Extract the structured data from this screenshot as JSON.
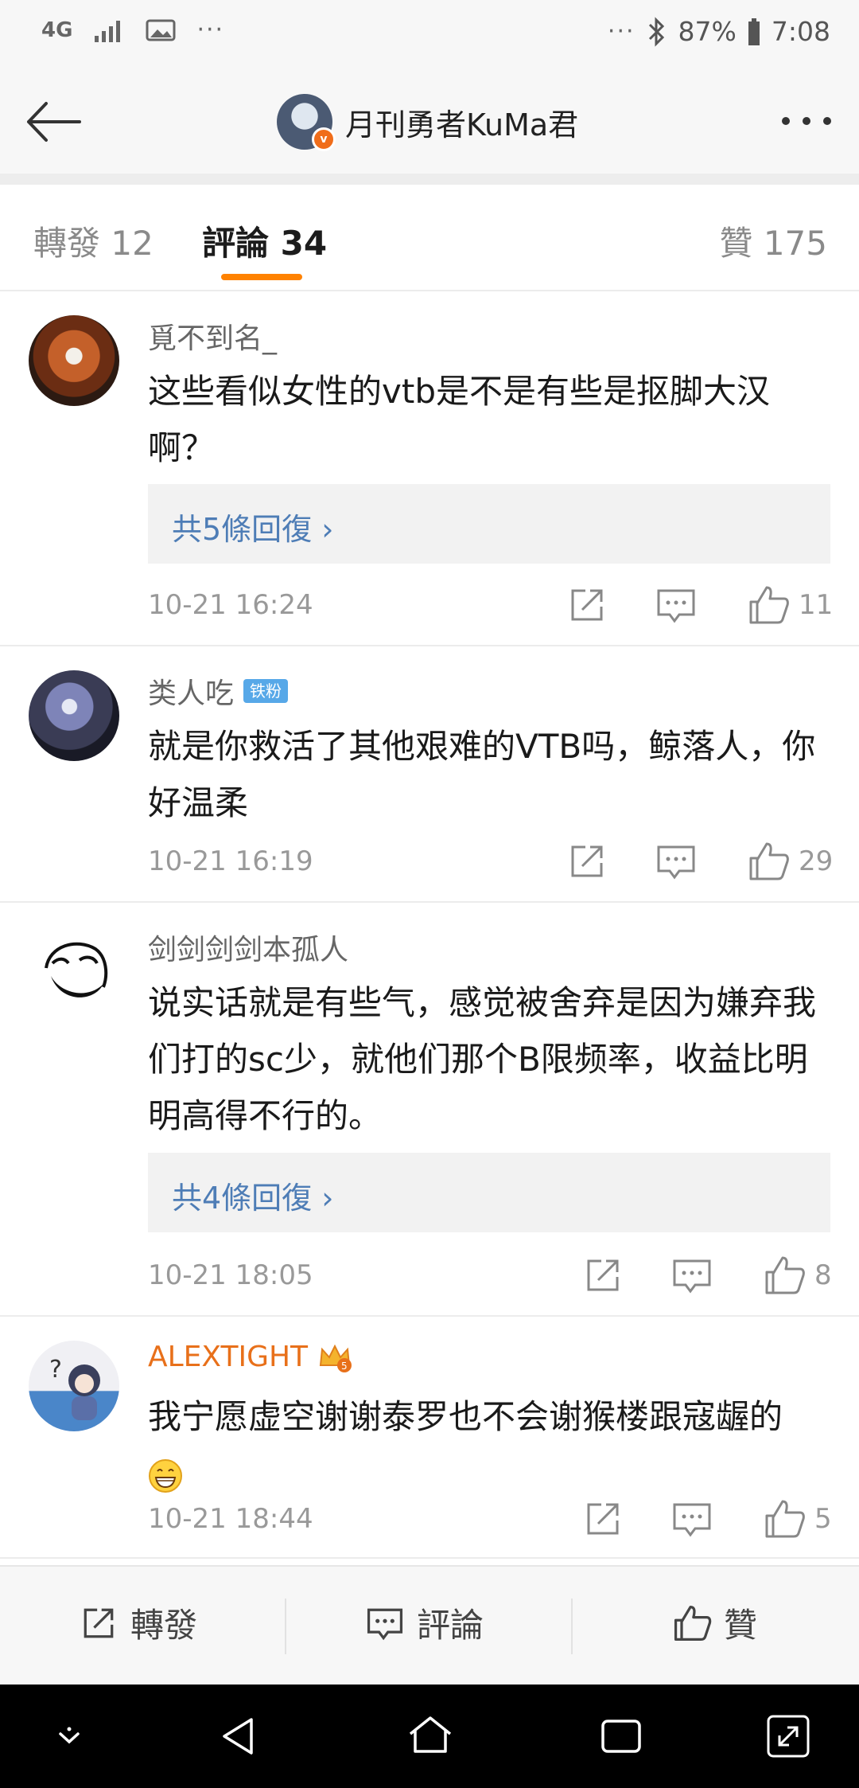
{
  "status_bar": {
    "network": "4G",
    "ellipsis_left": "···",
    "ellipsis_right": "···",
    "battery": "87%",
    "time": "7:08"
  },
  "header": {
    "author_name": "月刊勇者KuMa君",
    "verified_badge": "v"
  },
  "tabs": [
    {
      "label": "轉發 12"
    },
    {
      "label": "評論 34",
      "active": true
    },
    {
      "label": "贊 175"
    }
  ],
  "comments": [
    {
      "username": "覓不到名_",
      "text": "这些看似女性的vtb是不是有些是抠脚大汉啊？",
      "replies_label": "共5條回復 ›",
      "time": "10-21 16:24",
      "likes": "11"
    },
    {
      "username": "类人吃",
      "fan_badge": "铁粉",
      "text": "就是你救活了其他艰难的VTB吗，鲸落人，你好温柔",
      "time": "10-21 16:19",
      "likes": "29"
    },
    {
      "username": "剑剑剑剑本孤人",
      "text": "说实话就是有些气，感觉被舍弃是因为嫌弃我们打的sc少，就他们那个B限频率，收益比明明高得不行的。",
      "replies_label": "共4條回復 ›",
      "time": "10-21 18:05",
      "likes": "8"
    },
    {
      "username": "ALEXTIGHT",
      "text": "我宁愿虚空谢谢泰罗也不会谢猴楼跟寇龌的",
      "time": "10-21 18:44",
      "likes": "5"
    }
  ],
  "action_bar": {
    "repost_label": "轉發",
    "comment_label": "評論",
    "like_label": "贊"
  },
  "colors": {
    "accent": "#ff8200",
    "link": "#4e7db6",
    "vip_name": "#e8701a",
    "fan_badge": "#57a8e8"
  },
  "icons": [
    "share-icon",
    "comment-icon",
    "like-icon",
    "back-icon",
    "more-icon",
    "crown-icon",
    "grin-emoji-icon"
  ]
}
